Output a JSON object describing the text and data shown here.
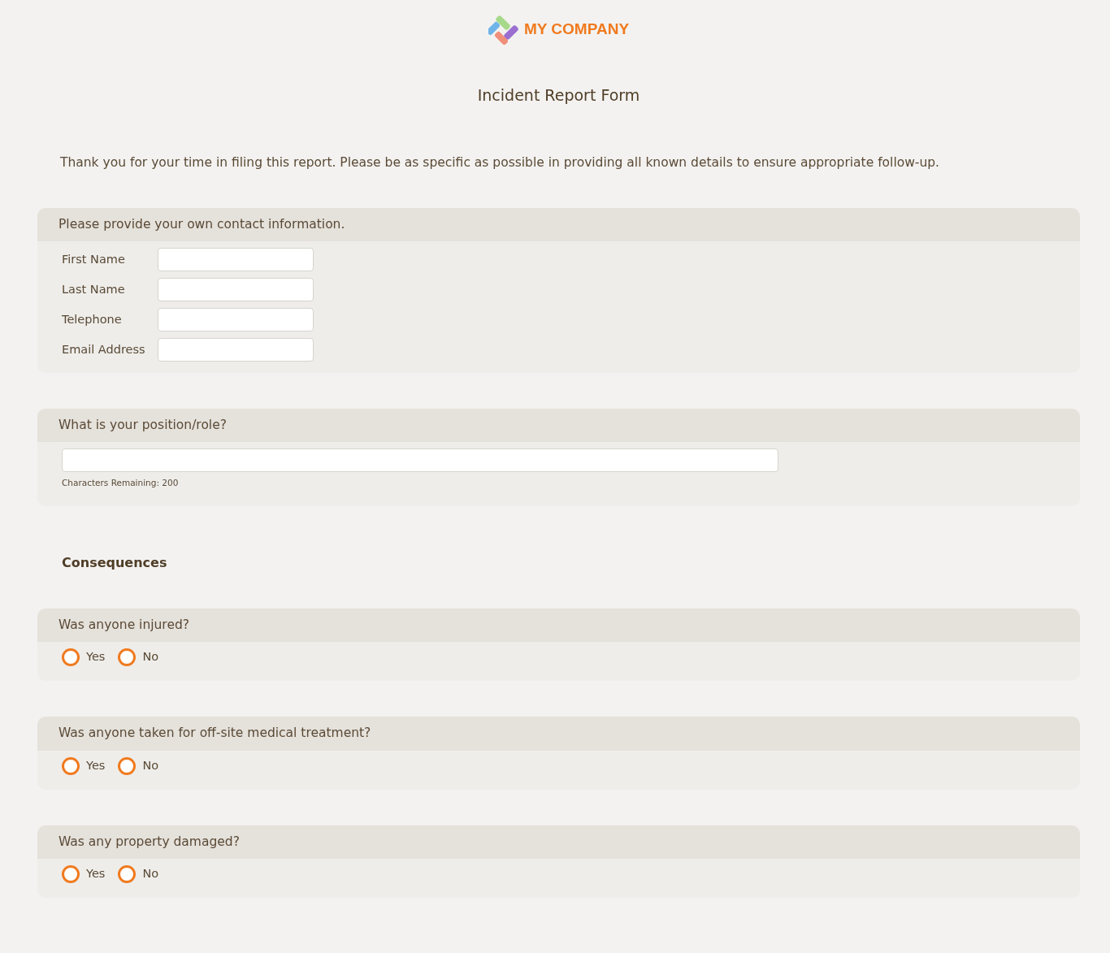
{
  "logo": {
    "text": "MY COMPANY"
  },
  "title": "Incident Report Form",
  "intro": "Thank you for your time in filing this report. Please be as specific as possible in providing all known details to ensure appropriate follow-up.",
  "sections": [
    {
      "kind": "fields",
      "title": "Please provide your own contact information.",
      "fields": [
        {
          "label": "First Name"
        },
        {
          "label": "Last Name"
        },
        {
          "label": "Telephone"
        },
        {
          "label": "Email Address"
        }
      ]
    },
    {
      "kind": "text",
      "title": "What is your position/role?",
      "hint": "Characters Remaining: 200"
    },
    {
      "kind": "heading",
      "title": "Consequences"
    },
    {
      "kind": "radio",
      "title": "Was anyone injured?",
      "options": [
        {
          "label": "Yes",
          "selected": false
        },
        {
          "label": "No",
          "selected": false
        }
      ]
    },
    {
      "kind": "radio",
      "title": "Was anyone taken for off-site medical treatment?",
      "options": [
        {
          "label": "Yes",
          "selected": false
        },
        {
          "label": "No",
          "selected": false
        }
      ]
    },
    {
      "kind": "radio",
      "title": "Was any property damaged?",
      "options": [
        {
          "label": "Yes",
          "selected": false
        },
        {
          "label": "No",
          "selected": false
        }
      ]
    }
  ]
}
